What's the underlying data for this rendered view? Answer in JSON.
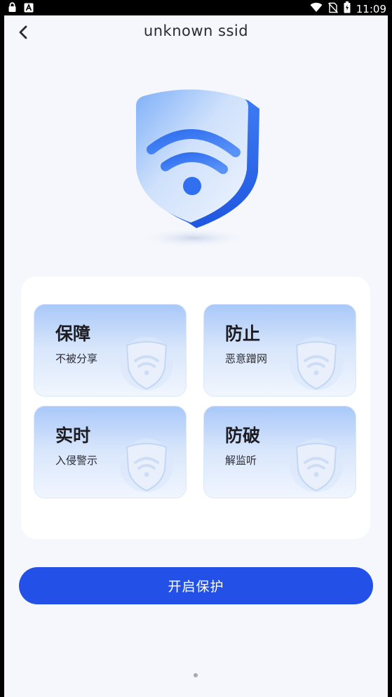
{
  "status_bar": {
    "time": "11:09",
    "left_icons": [
      "lock-icon",
      "a-badge-icon"
    ],
    "right_icons": [
      "wifi-icon",
      "no-sim-icon",
      "battery-icon"
    ]
  },
  "header": {
    "title": "unknown ssid",
    "back_icon": "back-arrow-icon"
  },
  "hero": {
    "icon": "wifi-shield-icon"
  },
  "features": [
    {
      "title": "保障",
      "subtitle": "不被分享",
      "icon": "wifi-shield-icon"
    },
    {
      "title": "防止",
      "subtitle": "恶意蹭网",
      "icon": "wifi-shield-icon"
    },
    {
      "title": "实时",
      "subtitle": "入侵警示",
      "icon": "wifi-shield-icon"
    },
    {
      "title": "防破",
      "subtitle": "解监听",
      "icon": "wifi-shield-icon"
    }
  ],
  "cta": {
    "label": "开启保护"
  },
  "colors": {
    "primary": "#2350e6",
    "background": "#f5f7fc",
    "card": "#ffffff",
    "feature_gradient_top": "#a9c8f9"
  }
}
